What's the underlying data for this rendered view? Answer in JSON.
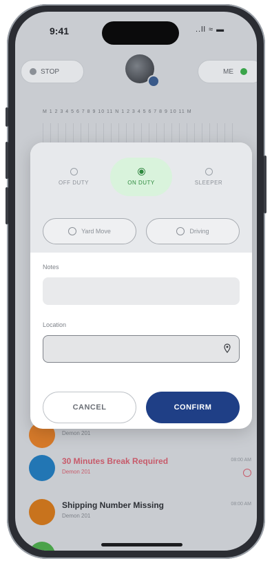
{
  "status_bar": {
    "time": "9:41",
    "signal": "..ll ≈ ▬"
  },
  "topbar": {
    "left_pill": "STOP",
    "right_pill": "ME"
  },
  "modal": {
    "duty_options": [
      "OFF DUTY",
      "ON DUTY",
      "SLEEPER"
    ],
    "selected": "ON DUTY",
    "special_options": [
      "Yard Move",
      "Driving"
    ],
    "notes_label": "Notes",
    "location_label": "Location",
    "cancel_label": "CANCEL",
    "confirm_label": "CONFIRM"
  },
  "list": [
    {
      "title": "",
      "subtitle": "Demon 201",
      "time": "",
      "icon_text": "",
      "color": "#d67a2a",
      "alert": false
    },
    {
      "title": "30 Minutes Break Required",
      "subtitle": "Demon 201",
      "time": "08:00 AM",
      "icon_text": "",
      "color": "#2276b4",
      "alert": true
    },
    {
      "title": "Shipping Number Missing",
      "subtitle": "Demon 201",
      "time": "08:00 AM",
      "icon_text": "",
      "color": "#c8731d",
      "alert": false
    }
  ],
  "colors": {
    "accent": "#1f3f86",
    "on_duty": "#2e8a3e",
    "warning": "#c75a6a"
  }
}
